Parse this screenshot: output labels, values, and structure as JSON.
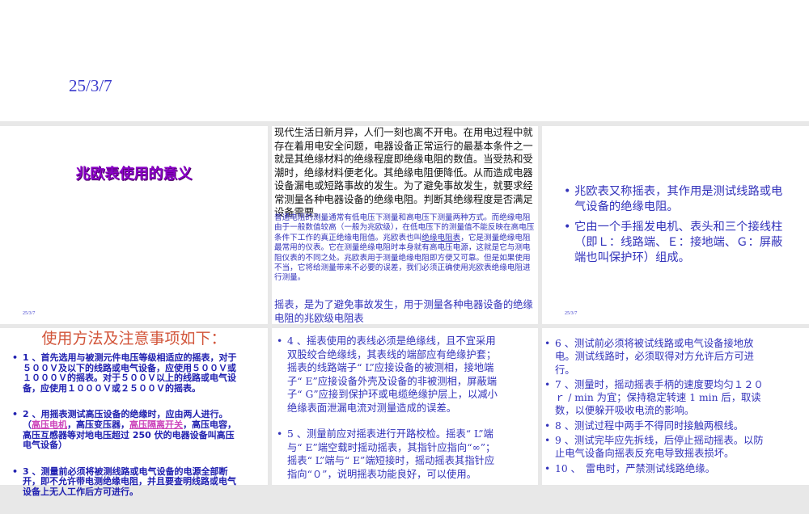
{
  "slide_top": {
    "date": "25/3/7"
  },
  "slide_title": {
    "title": "兆欧表使用的意义",
    "footer_date": "25/3/7"
  },
  "slide_intro": {
    "paragraph_main": "现代生活日新月异，人们一刻也离不开电。在用电过程中就存在着用电安全问题，电器设备正常运行的最基本条件之一就是其绝缘材料的绝缘程度即绝缘电阻的数值。当受热和受潮时，绝缘材料便老化。其绝缘电阻便降低。从而造成电器设备漏电或短路事故的发生。为了避免事故发生，就要求经常测量各种电器设备的绝缘电阻。判断其绝缘程度是否满足设备需要。",
    "paragraph_small_1": "普通电阻的测量通常有低电压下测量和高电压下测量两种方式。而绝缘电阻由于一般数值较高（一般为兆欧级），在低电压下的测量值不能反映在高电压条件下工作的真正绝缘电阻值。兆欧表也叫",
    "paragraph_small_link": "绝缘电阻表",
    "paragraph_small_2": "，它是测量绝缘电阻最常用的仪表。它在测量绝缘电阻时本身就有高电压电源，这就是它与测电阻仪表的不同之处。兆欧表用于测量绝缘电阻即方便又可靠。但是如果使用不当，它将给测量带来不必要的误差，我们必须正确使用兆欧表绝缘电阻进行测量。",
    "paragraph_bottom": "摇表，是为了避免事故发生，用于测量各种电器设备的绝缘电阻的兆欧级电阻表"
  },
  "slide_definition": {
    "bullets": [
      "兆欧表又称摇表，其作用是测试线路或电气设备的绝缘电阻。",
      "它由一个手摇发电机、表头和三个接线柱（即Ｌ：线路端、Ｅ：接地端、Ｇ：屏蔽端也叫保护环）组成。"
    ],
    "footer_date": "25/3/7"
  },
  "slide_usage_1": {
    "title": "使用方法及注意事项如下：",
    "item1": "1 、首先选用与被测元件电压等级相适应的摇表，对于５００Ｖ及以下的线路或电气设备，应使用５００Ｖ或１０００Ｖ的摇表。对于５００Ｖ以上的线路或电气设备，应使用１０００Ｖ或２５００Ｖ的摇表。",
    "item2_a": "2 、用摇表测试高压设备的绝缘时，应由两人进行。（",
    "item2_link1": "高压电机",
    "item2_b": "，高压变压器，",
    "item2_link2": "高压隔离开关",
    "item2_c": "，高压电容，高压互感器等对地电压超过 250 伏的电器设备叫高压电气设备）",
    "item3": "3 、测量前必须将被测线路或电气设备的电源全部断开，即不允许带电测绝缘电阻，并且要查明线路或电气设备上无人工作后方可进行。"
  },
  "slide_usage_2": {
    "bullets": [
      "4 、摇表使用的表线必须是绝缘线，且不宜采用双股绞合绝缘线，其表线的端部应有绝缘护套；摇表的线路端子“ L”应接设备的被测相，接地端子“ E”应接设备外壳及设备的非被测相，屏蔽端子“ G”应接到保护环或电缆绝缘护层上，以减小绝缘表面泄漏电流对测量造成的误差。",
      "5 、测量前应对摇表进行开路校检。摇表“ L”端与“ E”端空载时摇动摇表，其指针应指向“∞”；摇表“ L”端与“ E”端短接时，摇动摇表其指针应指向“０”，说明摇表功能良好，可以使用。"
    ]
  },
  "slide_usage_3": {
    "bullets": [
      "6 、测试前必须将被试线路或电气设备接地放电。测试线路时，必须取得对方允许后方可进行。",
      "7 、测量时，摇动摇表手柄的速度要均匀１２０ｒ / min 为宜；保持稳定转速 1 min 后，取读数，以便躲开吸收电流的影响。",
      "8 、测试过程中两手不得同时接触两根线。",
      "9 、测试完毕应先拆线，后停止摇动摇表。以防止电气设备向摇表反充电导致摇表损坏。",
      "10 、　雷电时，严禁测试线路绝缘。"
    ]
  }
}
